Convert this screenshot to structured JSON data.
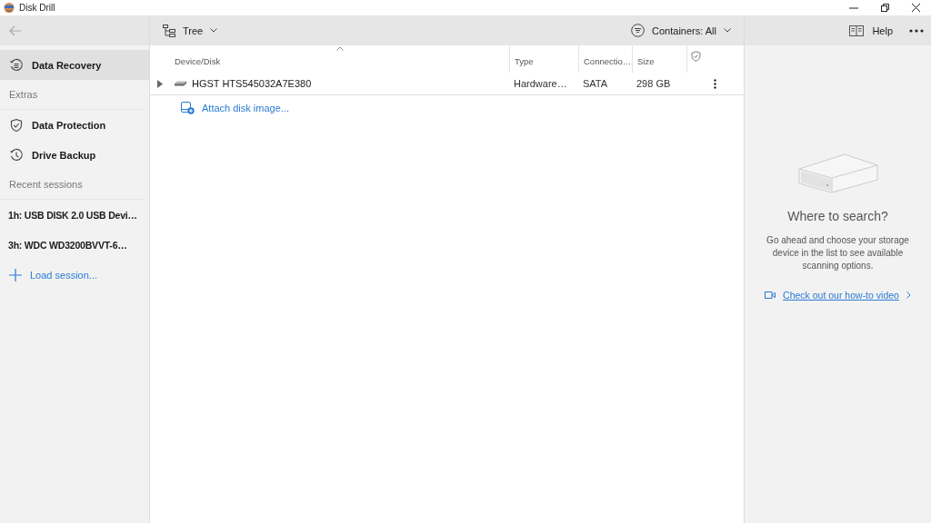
{
  "window": {
    "title": "Disk Drill"
  },
  "toolbar": {
    "view": "Tree",
    "filter": "Containers: All",
    "help": "Help"
  },
  "sidebar": {
    "items": [
      {
        "kind": "nav",
        "label": "Data Recovery",
        "selected": true
      },
      {
        "kind": "header",
        "label": "Extras"
      },
      {
        "kind": "nav",
        "label": "Data Protection",
        "selected": false
      },
      {
        "kind": "nav",
        "label": "Drive Backup",
        "selected": false
      },
      {
        "kind": "header",
        "label": "Recent sessions"
      },
      {
        "kind": "session",
        "label": "1h: USB DISK 2.0 USB Devi…",
        "selected": false
      },
      {
        "kind": "session",
        "label": "3h: WDC WD3200BVVT-6…",
        "selected": false
      },
      {
        "kind": "action",
        "label": "Load session..."
      }
    ]
  },
  "table": {
    "columns": [
      {
        "label": "Device/Disk",
        "sorted": true
      },
      {
        "label": "Type",
        "sorted": false
      },
      {
        "label": "Connectio…",
        "sorted": false
      },
      {
        "label": "Size",
        "sorted": false
      }
    ],
    "rows": [
      {
        "expanded": false,
        "name": "HGST HTS545032A7E380",
        "type": "Hardware…",
        "connection": "SATA",
        "size": "298 GB"
      }
    ],
    "attach_link": "Attach disk image..."
  },
  "info": {
    "title": "Where to search?",
    "body": "Go ahead and choose your storage device in the list to see available scanning options.",
    "link": "Check out our how-to video"
  }
}
